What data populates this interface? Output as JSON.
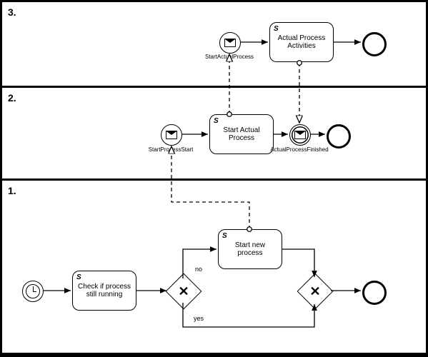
{
  "lanes": {
    "top": {
      "number": "3."
    },
    "middle": {
      "number": "2."
    },
    "bottom": {
      "number": "1."
    }
  },
  "tasks": {
    "actual_process_activities": {
      "label": "Actual Process Activities"
    },
    "start_actual_process": {
      "label": "Start Actual Process"
    },
    "check_running": {
      "label": "Check if process still running"
    },
    "start_new_process": {
      "label": "Start new process"
    }
  },
  "events": {
    "start_actual_proc": {
      "label": "StartActualProcess"
    },
    "start_process_start": {
      "label": "StartProcessStart"
    },
    "actual_process_finished": {
      "label": "ActualProcessFinished"
    }
  },
  "gateway_labels": {
    "no": "no",
    "yes": "yes"
  },
  "task_marker": "S"
}
